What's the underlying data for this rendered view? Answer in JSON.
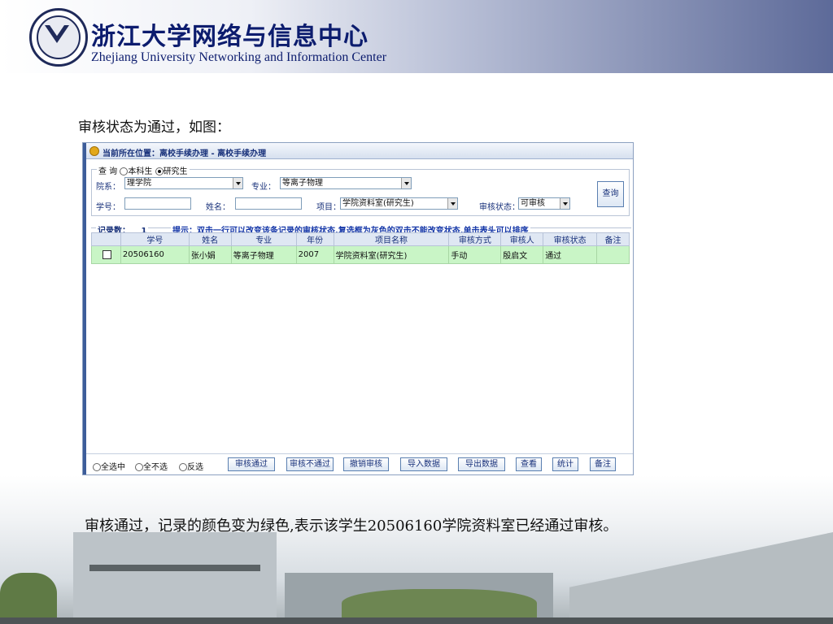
{
  "header": {
    "title_cn": "浙江大学网络与信息中心",
    "title_en": "Zhejiang University Networking and Information Center",
    "logo_icon": "university-seal-icon",
    "brand_color": "#0c1c6e"
  },
  "caption_top": "审核状态为通过，如图：",
  "caption_bottom": "审核通过，记录的颜色变为绿色,表示该学生20506160学院资料室已经通过审核。",
  "window": {
    "breadcrumb": "当前所在位置：离校手续办理 - 离校手续办理",
    "query": {
      "legend": "查 询",
      "radio_undergrad": "本科生",
      "radio_grad": "研究生",
      "selected": "研究生",
      "dept_label": "院系：",
      "dept_value": "理学院",
      "major_label": "专业：",
      "major_value": "等离子物理",
      "student_id_label": "学号：",
      "student_id_value": "",
      "name_label": "姓名：",
      "name_value": "",
      "item_label": "项目：",
      "item_value": "学院资料室(研究生)",
      "status_label": "审核状态：",
      "status_value": "可审核",
      "search_button": "查询"
    },
    "results": {
      "count_label": "记录数：",
      "count": "1",
      "hint": "提示：双击一行可以改变该条记录的审核状态,复选框为灰色的双击不能改变状态,单击表头可以排序",
      "columns": [
        "学号",
        "姓名",
        "专业",
        "年份",
        "项目名称",
        "审核方式",
        "审核人",
        "审核状态",
        "备注"
      ],
      "rows": [
        [
          "20506160",
          "张小娟",
          "等离子物理",
          "2007",
          "学院资料室(研究生)",
          "手动",
          "殷启文",
          "通过",
          ""
        ]
      ],
      "approved_row_color": "#c9f5c6"
    },
    "bottom": {
      "select_all": "全选中",
      "select_none": "全不选",
      "invert": "反选",
      "btn_approve": "审核通过",
      "btn_reject": "审核不通过",
      "btn_revoke": "撤销审核",
      "btn_import": "导入数据",
      "btn_export": "导出数据",
      "btn_view": "查看",
      "btn_stats": "统计",
      "btn_note": "备注"
    }
  }
}
